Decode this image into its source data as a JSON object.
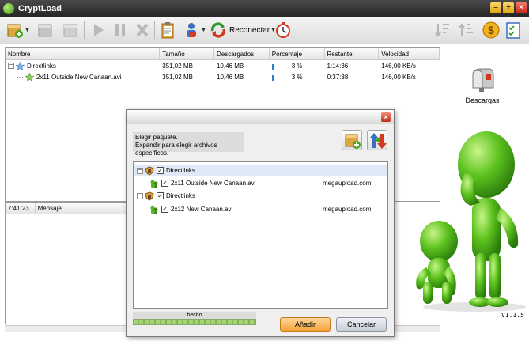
{
  "window": {
    "title": "CryptLoad"
  },
  "toolbar": {
    "reconnect_label": "Reconectar",
    "icons": [
      "add-package-icon",
      "package-icon",
      "package-disabled-icon",
      "start-icon",
      "pause-icon",
      "stop-icon",
      "clipboard-icon",
      "user-icon",
      "reconnect-icon",
      "stopwatch-icon",
      "sort-down-icon",
      "sort-up-icon",
      "donate-icon",
      "checklist-icon"
    ]
  },
  "downloads": {
    "columns": [
      "Nombre",
      "Tamaño",
      "Descargados",
      "Porcentaje",
      "Restante",
      "Velocidad"
    ],
    "rows": [
      {
        "name": "Directlinks",
        "size": "351,02 MB",
        "downloaded": "10,46 MB",
        "percent": "3 %",
        "remaining": "1:14:36",
        "speed": "146,00 KB/s",
        "progress": 0.03
      },
      {
        "name": "2x11 Outside New Canaan.avi",
        "size": "351,02 MB",
        "downloaded": "10,46 MB",
        "percent": "3 %",
        "remaining": "0:37:38",
        "speed": "146,00 KB/s",
        "progress": 0.03
      }
    ]
  },
  "side": {
    "descargas_label": "Descargas"
  },
  "log": {
    "time": "7:41:23",
    "header": "Mensaje"
  },
  "version": "V1.1.5",
  "dialog": {
    "info_line1": "Elegir paquete.",
    "info_line2": "Expandir para elegir archivos específicos.",
    "packages": [
      {
        "name": "Directlinks",
        "file": "2x11 Outside New Canaan.avi",
        "host": "megaupload.com"
      },
      {
        "name": "Directlinks",
        "file": "2x12 New Canaan.avi",
        "host": "megaupload.com"
      }
    ],
    "progress_label": "hecho",
    "progress": 1.0,
    "add_button": "Añadir",
    "cancel_button": "Cancelar"
  },
  "colors": {
    "accent": "#2d7fd0",
    "title_bg": "#2e2e2e",
    "add_button": "#f4a23a",
    "mascot": "#4fb620"
  }
}
